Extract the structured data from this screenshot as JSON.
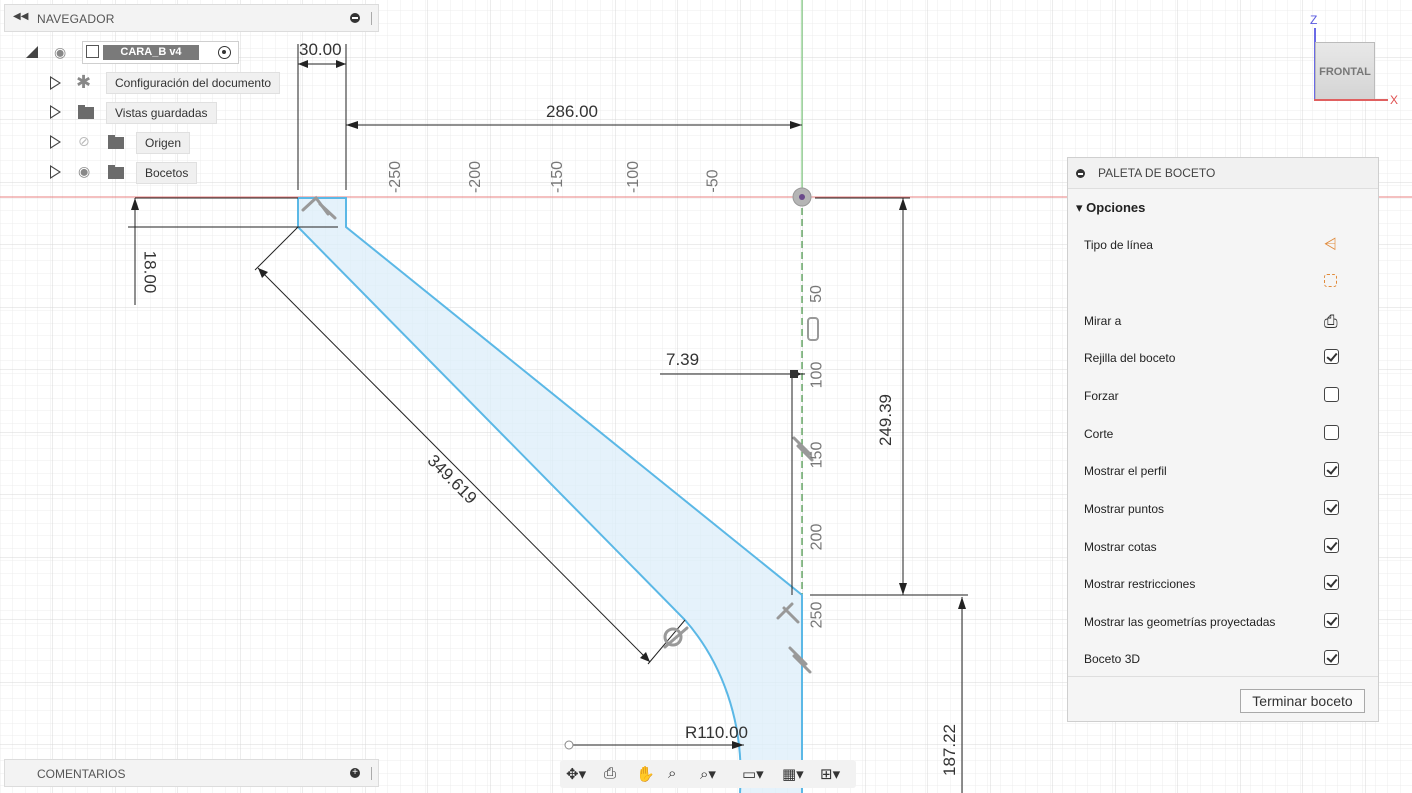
{
  "navigator": {
    "title": "NAVEGADOR",
    "component": "CARA_B v4",
    "items": [
      {
        "label": "Configuración del documento",
        "icon": "gear-icon"
      },
      {
        "label": "Vistas guardadas",
        "icon": "folder-icon"
      },
      {
        "label": "Origen",
        "icon": "folder-icon",
        "visibility": "hidden"
      },
      {
        "label": "Bocetos",
        "icon": "folder-icon",
        "visibility": "visible"
      }
    ]
  },
  "comments": {
    "title": "COMENTARIOS"
  },
  "viewcube": {
    "face": "FRONTAL",
    "axis_z": "Z",
    "axis_x": "X"
  },
  "palette": {
    "title": "PALETA DE BOCETO",
    "section": "Opciones",
    "rows": [
      {
        "label": "Tipo de línea",
        "control": "linetype-icon"
      },
      {
        "label": "",
        "control": "construction-icon"
      },
      {
        "label": "Mirar a",
        "control": "look-at-icon"
      },
      {
        "label": "Rejilla del boceto",
        "checked": true
      },
      {
        "label": "Forzar",
        "checked": false
      },
      {
        "label": "Corte",
        "checked": false
      },
      {
        "label": "Mostrar el perfil",
        "checked": true
      },
      {
        "label": "Mostrar puntos",
        "checked": true
      },
      {
        "label": "Mostrar cotas",
        "checked": true
      },
      {
        "label": "Mostrar restricciones",
        "checked": true
      },
      {
        "label": "Mostrar las geometrías proyectadas",
        "checked": true
      },
      {
        "label": "Boceto 3D",
        "checked": true
      }
    ],
    "finish_button": "Terminar boceto"
  },
  "dimensions": {
    "width_top": "30.00",
    "horizontal_offset": "286.00",
    "thickness": "18.00",
    "diagonal": "349.619",
    "offset_small": "7.39",
    "vertical_height": "249.39",
    "radius": "R110.00",
    "lower_height": "187.22"
  },
  "ruler": {
    "horizontal": [
      "-250",
      "-200",
      "-150",
      "-100",
      "-50"
    ],
    "vertical": [
      "50",
      "100",
      "150",
      "200",
      "250"
    ]
  },
  "colors": {
    "sketch_line": "#5bb8e6",
    "profile_fill": "#dceefa",
    "x_axis": "#e88080",
    "y_axis": "#6cc66c",
    "grid_minor": "#ececec",
    "grid_major": "#d6d6d6"
  }
}
